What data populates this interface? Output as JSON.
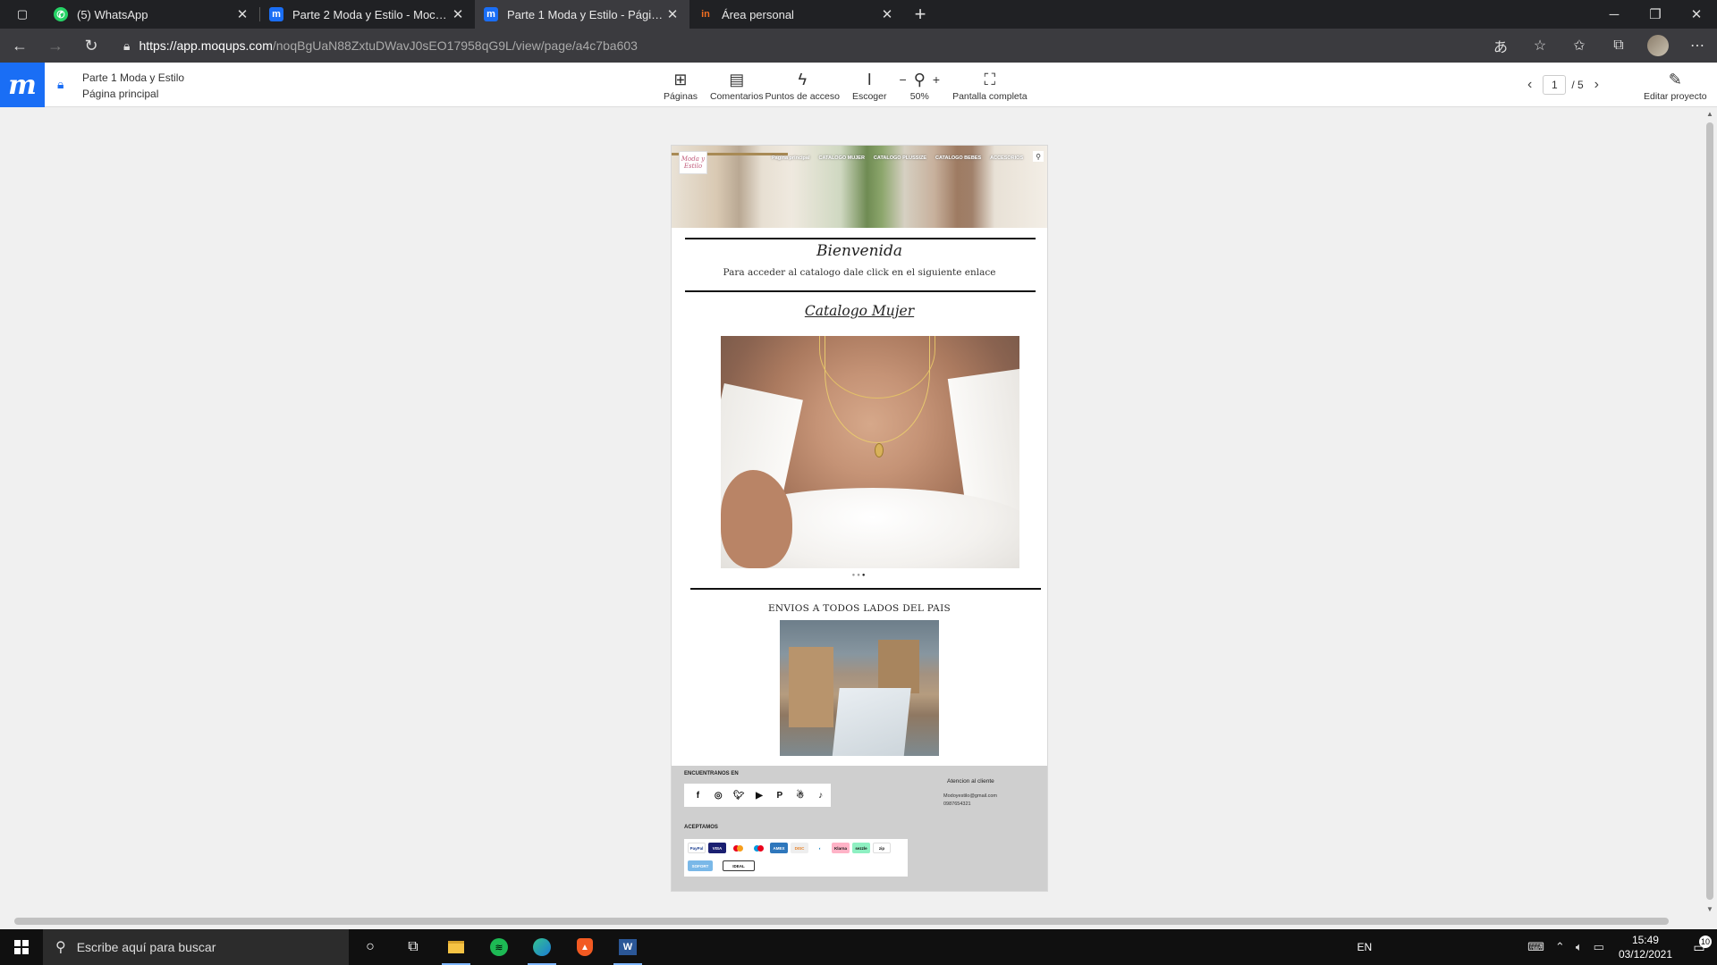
{
  "browser": {
    "tabs": [
      {
        "title": "(5) WhatsApp",
        "favicon": "whatsapp-icon",
        "color": "#25D366",
        "active": false
      },
      {
        "title": "Parte 2 Moda y Estilo - Mochilas",
        "favicon": "moqups-icon",
        "color": "#1a6ef5",
        "active": false
      },
      {
        "title": "Parte 1 Moda y Estilo - Página principal",
        "favicon": "moqups-icon",
        "color": "#1a6ef5",
        "active": true
      },
      {
        "title": "Área personal",
        "favicon": "in-icon",
        "color": "#f36f21",
        "active": false
      }
    ],
    "url_host": "https://app.moqups.com",
    "url_path": "/noqBgUaN88ZxtuDWavJ0sEO17958qG9L/view/page/a4c7ba603"
  },
  "moqups": {
    "project_name": "Parte 1 Moda y Estilo",
    "page_name": "Página principal",
    "tools": {
      "pages": "Páginas",
      "comments": "Comentarios",
      "hotspots": "Puntos de acceso",
      "select": "Escoger",
      "zoom": "50%",
      "fullscreen": "Pantalla completa",
      "edit": "Editar proyecto"
    },
    "pager": {
      "current": "1",
      "total": "/ 5"
    }
  },
  "mockup": {
    "logo_text": "Moda y Estilo",
    "menu": [
      "Pagina principal",
      "CATALOGO MUJER",
      "CATALOGO PLUSSIZE",
      "CATALOGO BEBES",
      "ACCESORIOS"
    ],
    "welcome_title": "Bienvenida",
    "welcome_sub": "Para acceder al catalogo dale click en el siguiente enlace",
    "catalog_link": "Catalogo Mujer",
    "shipping_title": "ENVIOS A TODOS LADOS DEL PAIS",
    "footer": {
      "find_us": "ENCUENTRANOS EN",
      "we_accept": "ACEPTAMOS",
      "contact_title": "Atencion al cliente",
      "email": "Modoyestilo@gmail.com",
      "phone": "0987654321",
      "social_icons": [
        "facebook-icon",
        "instagram-icon",
        "twitter-icon",
        "youtube-icon",
        "pinterest-icon",
        "snapchat-icon",
        "tiktok-icon"
      ],
      "payments": [
        "PayPal",
        "VISA",
        "Mastercard",
        "Maestro",
        "Amex",
        "Discover",
        "Diners",
        "Klarna",
        "Sezzle",
        "Zip",
        "Sofort",
        "IDEAL"
      ]
    }
  },
  "taskbar": {
    "search_placeholder": "Escribe aquí para buscar",
    "lang": "EN",
    "time": "15:49",
    "date": "03/12/2021",
    "notifications": "10"
  }
}
